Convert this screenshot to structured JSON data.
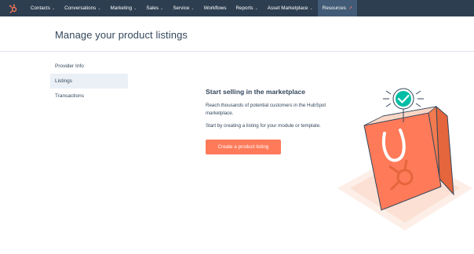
{
  "topnav": {
    "logo_icon": "hubspot-sprocket-icon",
    "items": [
      {
        "label": "Contacts",
        "dropdown": true
      },
      {
        "label": "Conversations",
        "dropdown": true
      },
      {
        "label": "Marketing",
        "dropdown": true
      },
      {
        "label": "Sales",
        "dropdown": true
      },
      {
        "label": "Service",
        "dropdown": true
      },
      {
        "label": "Workflows",
        "dropdown": false
      },
      {
        "label": "Reports",
        "dropdown": true
      },
      {
        "label": "Asset Marketplace",
        "dropdown": true
      },
      {
        "label": "Resources",
        "dropdown": false,
        "external": true
      }
    ],
    "chevron": "⌄",
    "external_icon": "↗"
  },
  "header": {
    "title": "Manage your product listings"
  },
  "sidebar": {
    "items": [
      {
        "label": "Provider Info",
        "active": false
      },
      {
        "label": "Listings",
        "active": true
      },
      {
        "label": "Transactions",
        "active": false
      }
    ]
  },
  "empty_state": {
    "title": "Start selling in the marketplace",
    "paragraph1": "Reach thousands of potential customers in the HubSpot marketplace.",
    "paragraph2": "Start by creating a listing for your module or template.",
    "cta_label": "Create a product listing"
  },
  "colors": {
    "nav_bg": "#2d3e50",
    "accent": "#ff7a59",
    "text": "#33475b",
    "active_bg": "#eaf0f6",
    "check": "#00bda5"
  }
}
